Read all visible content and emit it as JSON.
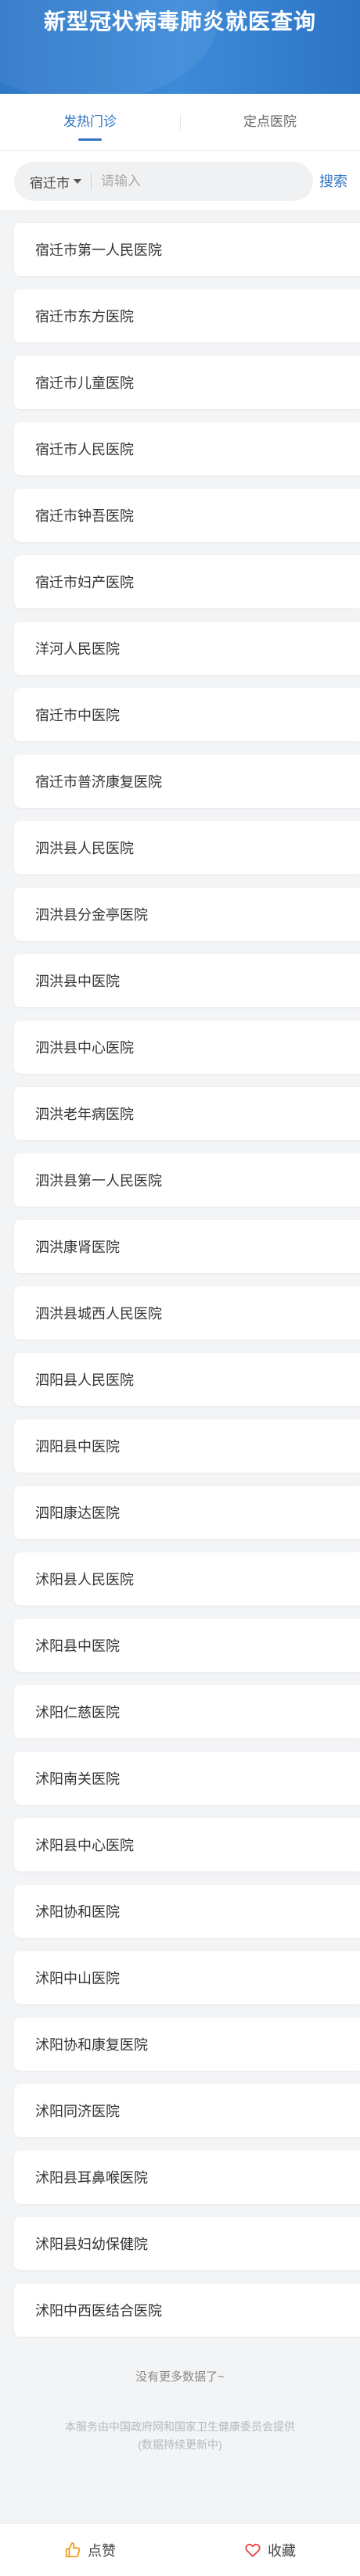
{
  "header": {
    "title": "新型冠状病毒肺炎就医查询"
  },
  "tabs": [
    {
      "label": "发热门诊",
      "active": true
    },
    {
      "label": "定点医院",
      "active": false
    }
  ],
  "search": {
    "city": "宿迁市",
    "placeholder": "请输入",
    "button_label": "搜索"
  },
  "hospitals": [
    "宿迁市第一人民医院",
    "宿迁市东方医院",
    "宿迁市儿童医院",
    "宿迁市人民医院",
    "宿迁市钟吾医院",
    "宿迁市妇产医院",
    "洋河人民医院",
    "宿迁市中医院",
    "宿迁市普济康复医院",
    "泗洪县人民医院",
    "泗洪县分金亭医院",
    "泗洪县中医院",
    "泗洪县中心医院",
    "泗洪老年病医院",
    "泗洪县第一人民医院",
    "泗洪康肾医院",
    "泗洪县城西人民医院",
    "泗阳县人民医院",
    "泗阳县中医院",
    "泗阳康达医院",
    "沭阳县人民医院",
    "沭阳县中医院",
    "沭阳仁慈医院",
    "沭阳南关医院",
    "沭阳县中心医院",
    "沭阳协和医院",
    "沭阳中山医院",
    "沭阳协和康复医院",
    "沭阳同济医院",
    "沭阳县耳鼻喉医院",
    "沭阳县妇幼保健院",
    "沭阳中西医结合医院"
  ],
  "footer": {
    "no_more": "没有更多数据了~",
    "disclaimer_line1": "本服务由中国政府网和国家卫生健康委员会提供",
    "disclaimer_line2": "(数据持续更新中)"
  },
  "bottom_bar": {
    "like_label": "点赞",
    "like_icon": "thumbs-up-icon",
    "favorite_label": "收藏",
    "favorite_icon": "heart-icon"
  },
  "colors": {
    "header_blue": "#2f78c8",
    "accent_blue": "#2f73c4",
    "like_icon_color": "#f0a020",
    "favorite_icon_color": "#e84b4b"
  }
}
